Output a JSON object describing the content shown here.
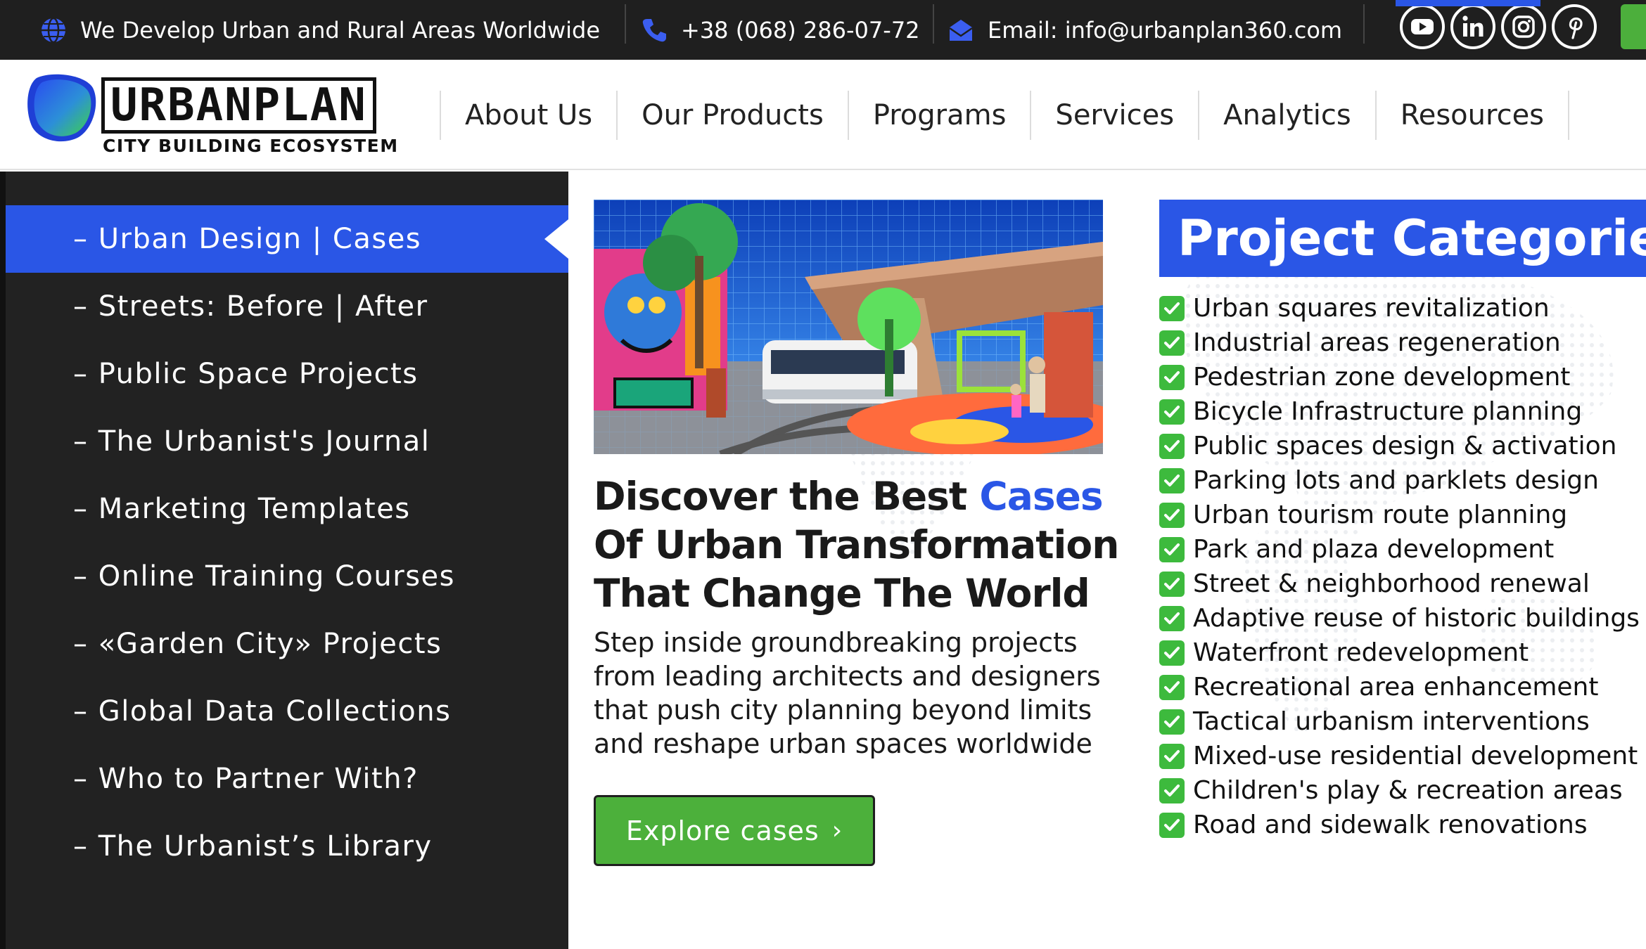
{
  "topbar": {
    "tagline": "We Develop Urban and Rural Areas Worldwide",
    "phone": "+38 (068) 286-07-72",
    "email": "Email: info@urbanplan360.com",
    "socials": [
      "youtube-icon",
      "linkedin-icon",
      "instagram-icon",
      "pinterest-icon"
    ]
  },
  "logo": {
    "title": "URBANPLAN",
    "subtitle": "CITY BUILDING ECOSYSTEM"
  },
  "nav": {
    "items": [
      "About Us",
      "Our Products",
      "Programs",
      "Services",
      "Analytics",
      "Resources"
    ],
    "active": "Resources"
  },
  "sidebar": {
    "items": [
      "– Urban Design | Cases",
      "– Streets: Before | After",
      "– Public Space Projects",
      "– The Urbanist's Journal",
      "– Marketing Templates",
      "– Online Training Courses",
      "– «Garden City» Projects",
      "– Global Data Collections",
      "– Who to Partner With?",
      "– The Urbanist’s Library"
    ],
    "active": "– Urban Design | Cases"
  },
  "feature": {
    "headline_part1": "Discover the Best ",
    "headline_accent": "Cases",
    "headline_part2": "Of Urban Transformation That Change The World",
    "description": "Step inside groundbreaking projects from leading architects and designers that push city planning beyond limits and reshape urban spaces worldwide",
    "cta_label": "Explore cases",
    "cta_icon": "chevron-right-icon"
  },
  "categories": {
    "title": "Project Categories:",
    "items": [
      "Urban squares revitalization",
      "Industrial areas regeneration",
      "Pedestrian zone development",
      "Bicycle Infrastructure planning",
      "Public spaces design & activation",
      "Parking lots and parklets design",
      "Urban tourism route planning",
      "Park and plaza development",
      "Street & neighborhood renewal",
      "Adaptive reuse of historic buildings",
      "Waterfront redevelopment",
      "Recreational area enhancement",
      "Tactical urbanism interventions",
      "Mixed-use residential development",
      "Children's play & recreation areas",
      "Road and sidewalk renovations"
    ]
  },
  "colors": {
    "accent_blue": "#2a56e6",
    "cta_green": "#4cb03b",
    "sidebar_bg": "#222222",
    "topbar_bg": "#1f1f1f"
  }
}
